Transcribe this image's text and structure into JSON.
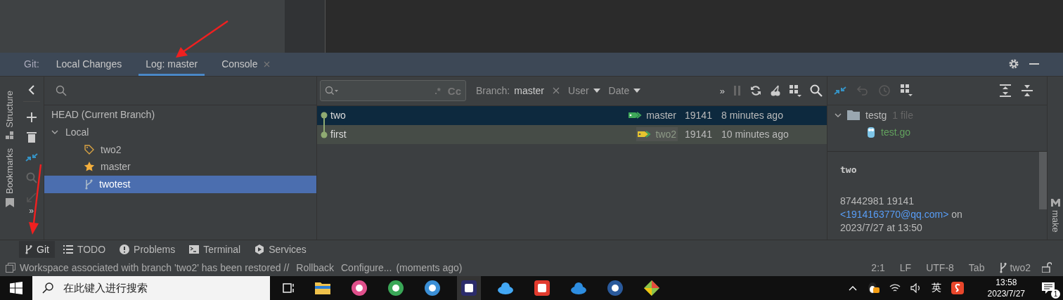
{
  "tool_window": {
    "label": "Git:",
    "tabs": [
      {
        "label": "Local Changes",
        "selected": false,
        "closable": false
      },
      {
        "label": "Log: master",
        "selected": true,
        "closable": false
      },
      {
        "label": "Console",
        "selected": false,
        "closable": true
      }
    ]
  },
  "left_strip": [
    "Structure",
    "Bookmarks"
  ],
  "right_strip": [
    "make"
  ],
  "branches": {
    "tree": [
      {
        "label": "HEAD (Current Branch)",
        "kind": "head",
        "selected": false
      },
      {
        "label": "Local",
        "kind": "group",
        "expanded": true,
        "selected": false,
        "children": [
          {
            "label": "two2",
            "kind": "tag",
            "selected": false
          },
          {
            "label": "master",
            "kind": "star",
            "selected": false
          },
          {
            "label": "twotest",
            "kind": "branch",
            "selected": true
          }
        ]
      }
    ]
  },
  "tools_overflow": "»",
  "log": {
    "search_toggles": [
      ".*",
      "Cc"
    ],
    "overflow": "»",
    "branch_filter": {
      "label": "Branch:",
      "value": "master"
    },
    "filters": [
      "User",
      "Date"
    ],
    "commits": [
      {
        "message": "two",
        "refs": [
          {
            "label": "master",
            "kind": "current"
          }
        ],
        "author": "19141",
        "time": "8 minutes ago",
        "selected": true,
        "hovered": false
      },
      {
        "message": "first",
        "refs": [
          {
            "label": "two2",
            "kind": "other"
          }
        ],
        "author": "19141",
        "time": "10 minutes ago",
        "selected": false,
        "hovered": true
      }
    ]
  },
  "changes": {
    "folder": "testg",
    "count": "1 file",
    "expanded": true,
    "files": [
      "test.go"
    ]
  },
  "details": {
    "subject": "two",
    "line": "87442981 19141",
    "email": "<1914163770@qq.com>",
    "on": "on",
    "date": "2023/7/27 at 13:50"
  },
  "bottom_tabs": [
    {
      "label": "Git",
      "selected": true,
      "kind": "git"
    },
    {
      "label": "TODO",
      "selected": false,
      "kind": "list"
    },
    {
      "label": "Problems",
      "selected": false,
      "kind": "problems"
    },
    {
      "label": "Terminal",
      "selected": false,
      "kind": "terminal"
    },
    {
      "label": "Services",
      "selected": false,
      "kind": "services"
    }
  ],
  "status": {
    "message": "Workspace associated with branch 'two2' has been restored //",
    "actions": [
      "Rollback",
      "Configure..."
    ],
    "time": "(moments ago)",
    "widgets": [
      "2:1",
      "LF",
      "UTF-8",
      "Tab"
    ],
    "vcs_branch": "two2"
  },
  "taskbar": {
    "search_placeholder": "在此键入进行搜索",
    "ime": "英",
    "time": "13:58",
    "date": "2023/7/27",
    "notifications": "1"
  }
}
